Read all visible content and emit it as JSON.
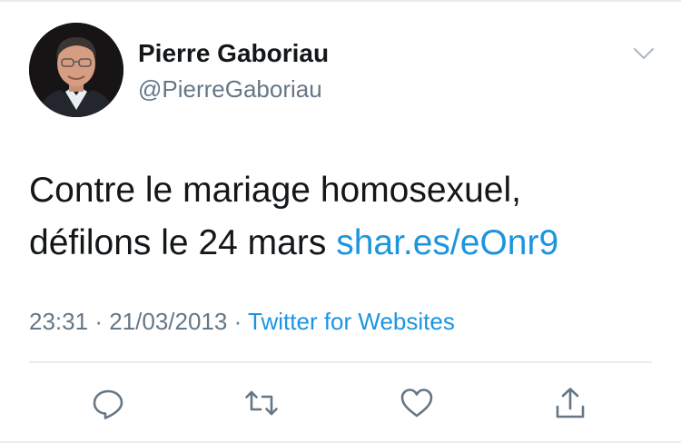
{
  "author": {
    "name": "Pierre Gaboriau",
    "handle": "@PierreGaboriau",
    "avatar": "avatar-photo"
  },
  "tweet": {
    "text": "Contre le mariage homosexuel,",
    "text_line2": "défilons le 24 mars",
    "link": "shar.es/eOnr9",
    "time": "23:31",
    "date": "21/03/2013",
    "separator": "·",
    "source": "Twitter for Websites"
  },
  "icons": {
    "menu": "chevron-down-icon",
    "reply": "reply-icon",
    "retweet": "retweet-icon",
    "like": "heart-icon",
    "share": "share-icon"
  },
  "colors": {
    "link": "#1b95e0",
    "secondary_text": "#657786",
    "primary_text": "#14171a",
    "divider": "#e6ecf0"
  }
}
